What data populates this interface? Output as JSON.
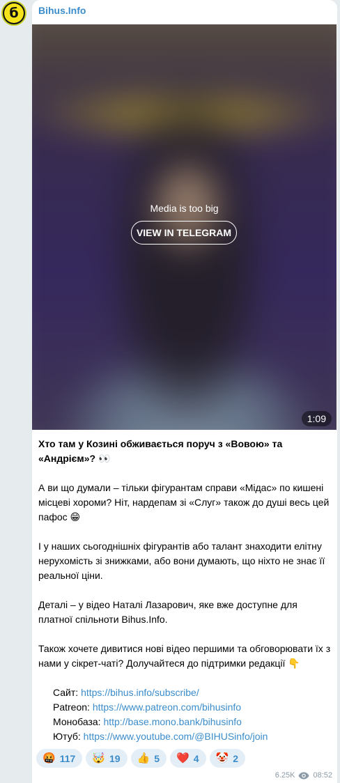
{
  "channel": {
    "name": "Bihus.Info",
    "avatar_glyph": "б"
  },
  "media": {
    "status": "Media is too big",
    "button_label": "VIEW IN TELEGRAM",
    "duration": "1:09"
  },
  "post": {
    "title": "Хто там у Козині обживається поруч з «Вовою» та «Андрієм»? 👀",
    "p1": "А ви що думали – тільки фігурантам справи «Мідас» по кишені місцеві хороми? Ніт, нардепам зі «Слуг» також до душі весь цей пафос 😁",
    "p2": "І у наших сьогоднішніх фігурантів або талант знаходити елітну нерухомість зі знижками, або вони думають, що ніхто не знає її реальної ціни.",
    "p3": "Деталі – у відео Наталі Лазарович, яке вже доступне для платної спільноти Bihus.Info.",
    "p4": "Також хочете дивитися нові відео першими та обговорювати їх з нами у сікрет-чаті? Долучайтеся до підтримки редакції 👇",
    "links": [
      {
        "label": "Сайт: ",
        "url": "https://bihus.info/subscribe/"
      },
      {
        "label": "Patreon: ",
        "url": "https://www.patreon.com/bihusinfo"
      },
      {
        "label": "Монобаза: ",
        "url": "http://base.mono.bank/bihusinfo"
      },
      {
        "label": "Ютуб: ",
        "url": "https://www.youtube.com/@BIHUSinfo/join"
      }
    ]
  },
  "reactions": [
    {
      "emoji": "🤬",
      "count": "117"
    },
    {
      "emoji": "🤯",
      "count": "19"
    },
    {
      "emoji": "👍",
      "count": "5"
    },
    {
      "emoji": "❤️",
      "count": "4"
    },
    {
      "emoji": "🤡",
      "count": "2"
    }
  ],
  "meta": {
    "views": "6.25K",
    "time": "08:52"
  },
  "colors": {
    "accent": "#3a8ccb",
    "background": "#e6ebee",
    "reaction_bg": "#e4eef7"
  }
}
